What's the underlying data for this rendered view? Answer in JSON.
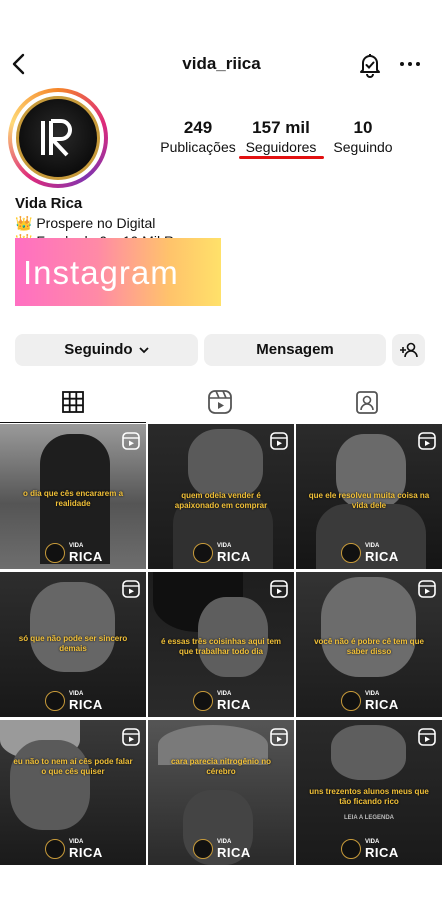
{
  "header": {
    "username": "vida_riica"
  },
  "profile": {
    "display_name": "Vida Rica",
    "bio_line_1": "👑 Prospere no Digital",
    "bio_line_2": "👑 Fundo de 0 a 10 Mil R..."
  },
  "stats": [
    {
      "value": "249",
      "label": "Publicações"
    },
    {
      "value": "157 mil",
      "label": "Seguidores"
    },
    {
      "value": "10",
      "label": "Seguindo"
    }
  ],
  "overlay": {
    "label": "Instagram"
  },
  "actions": {
    "follow_label": "Seguindo",
    "message_label": "Mensagem"
  },
  "posts": [
    {
      "caption": "o dia que cês encararem a realidade"
    },
    {
      "caption": "quem odeia vender é apaixonado em comprar"
    },
    {
      "caption": "que ele resolveu muita coisa na vida dele"
    },
    {
      "caption": "só que não pode ser sincero demais"
    },
    {
      "caption": "é essas três coisinhas aqui tem que trabalhar todo dia"
    },
    {
      "caption": "você não é pobre cê tem que saber disso"
    },
    {
      "caption": "eu não to nem aí cês pode falar o que cês quiser"
    },
    {
      "caption": "cara parecia nitrogênio no cérebro"
    },
    {
      "caption": "uns trezentos alunos meus que tão ficando rico"
    }
  ],
  "brand": {
    "small": "VIDA",
    "big": "RICA"
  },
  "post9_extra": "LEIA A LEGENDA",
  "colors": {
    "underline": "#e21010",
    "caption": "#f1c038",
    "gold": "#c79a3a"
  }
}
